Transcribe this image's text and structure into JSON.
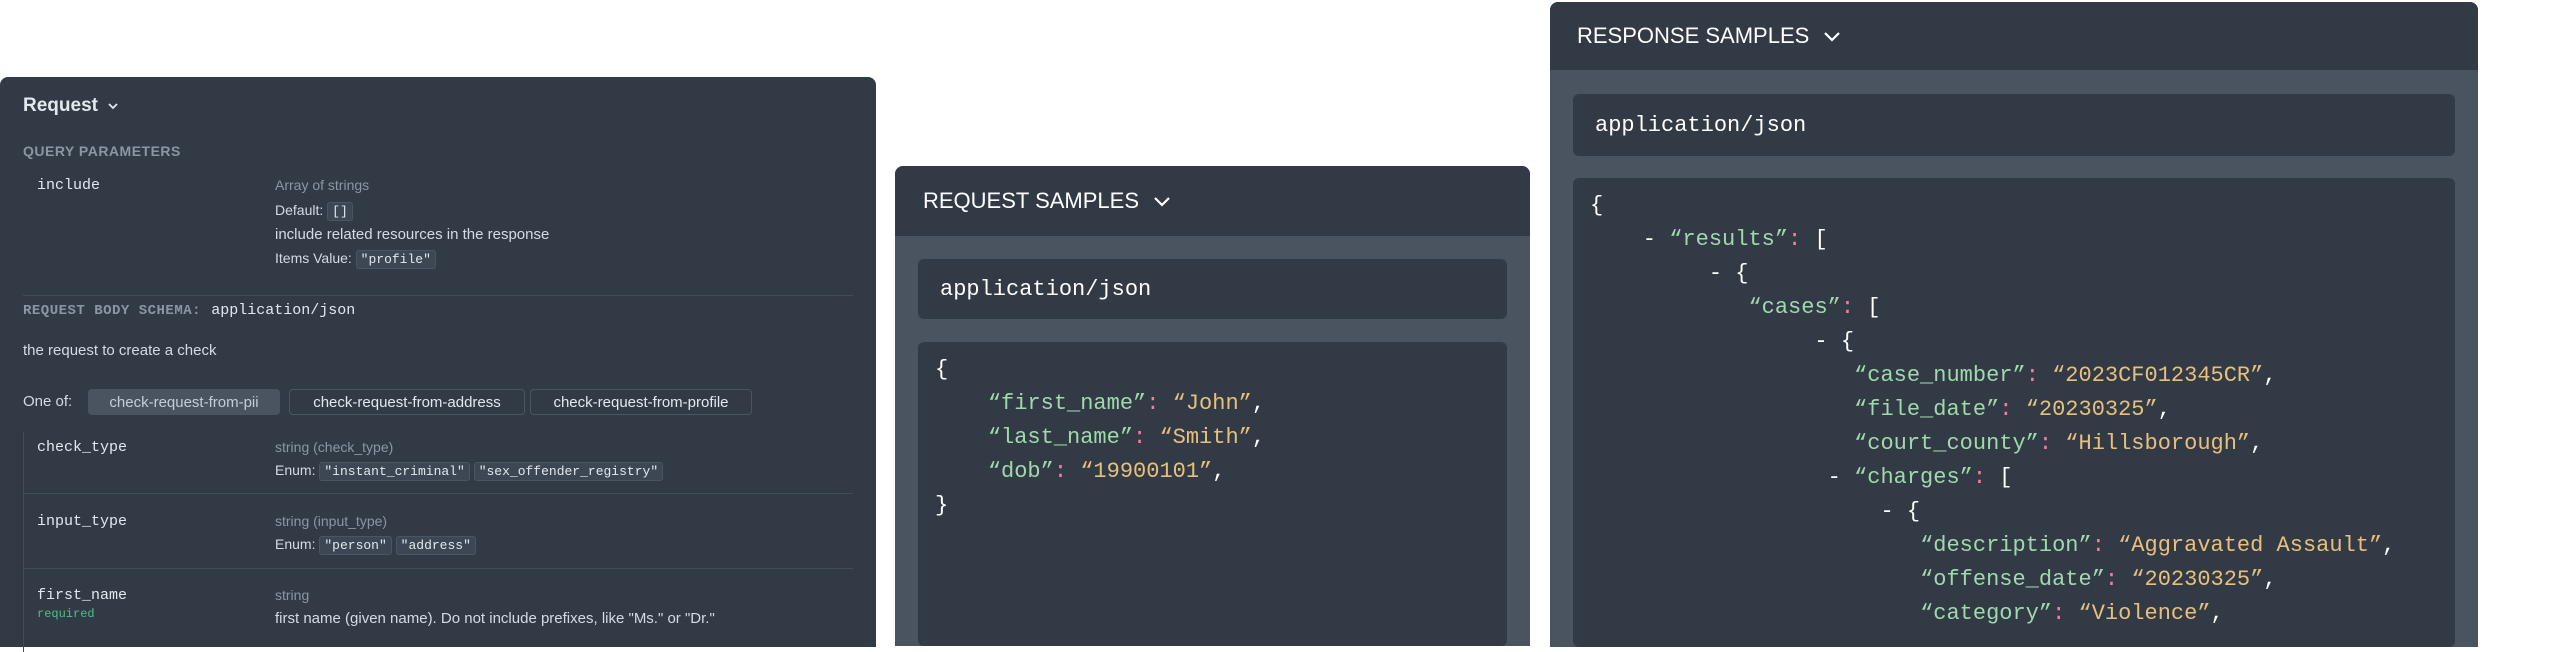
{
  "request": {
    "title": "Request",
    "query_params_heading": "QUERY PARAMETERS",
    "include": {
      "name": "include",
      "type": "Array of strings",
      "default_label": "Default:",
      "default_value": "[]",
      "description": "include related resources in the response",
      "items_label": "Items Value:",
      "items_value": "\"profile\""
    },
    "body_schema_label": "REQUEST BODY SCHEMA:",
    "body_schema_value": "application/json",
    "body_description": "the request to create a check",
    "one_of_label": "One of:",
    "one_of_tabs": [
      "check-request-from-pii",
      "check-request-from-address",
      "check-request-from-profile"
    ],
    "fields": [
      {
        "name": "check_type",
        "type": "string (check_type)",
        "enum_label": "Enum:",
        "enums": [
          "\"instant_criminal\"",
          "\"sex_offender_registry\""
        ]
      },
      {
        "name": "input_type",
        "type": "string (input_type)",
        "enum_label": "Enum:",
        "enums": [
          "\"person\"",
          "\"address\""
        ]
      },
      {
        "name": "first_name",
        "required": "required",
        "type": "string",
        "description": "first name (given name). Do not include prefixes, like \"Ms.\" or \"Dr.\""
      }
    ]
  },
  "request_samples": {
    "header": "REQUEST SAMPLES",
    "mime": "application/json",
    "lines": [
      [
        {
          "t": "p",
          "v": "{"
        }
      ],
      [
        {
          "t": "p",
          "v": "    "
        },
        {
          "t": "k",
          "v": "“first_name”"
        },
        {
          "t": "pu",
          "v": ": "
        },
        {
          "t": "s",
          "v": "“John”"
        },
        {
          "t": "p",
          "v": ","
        }
      ],
      [
        {
          "t": "p",
          "v": "    "
        },
        {
          "t": "k",
          "v": "“last_name”"
        },
        {
          "t": "pu",
          "v": ": "
        },
        {
          "t": "s",
          "v": "“Smith”"
        },
        {
          "t": "p",
          "v": ","
        }
      ],
      [
        {
          "t": "p",
          "v": "    "
        },
        {
          "t": "k",
          "v": "“dob”"
        },
        {
          "t": "pu",
          "v": ": "
        },
        {
          "t": "s",
          "v": "“19900101”"
        },
        {
          "t": "p",
          "v": ","
        }
      ],
      [
        {
          "t": "p",
          "v": "}"
        }
      ]
    ]
  },
  "response_samples": {
    "header": "RESPONSE SAMPLES",
    "mime": "application/json",
    "lines": [
      [
        {
          "t": "p",
          "v": "{"
        }
      ],
      [
        {
          "t": "p",
          "v": "    - "
        },
        {
          "t": "k",
          "v": "“results”"
        },
        {
          "t": "pu",
          "v": ": "
        },
        {
          "t": "p",
          "v": "["
        }
      ],
      [
        {
          "t": "p",
          "v": "         - {"
        }
      ],
      [
        {
          "t": "p",
          "v": "            "
        },
        {
          "t": "k",
          "v": "“cases”"
        },
        {
          "t": "pu",
          "v": ": "
        },
        {
          "t": "p",
          "v": "["
        }
      ],
      [
        {
          "t": "p",
          "v": "                 - {"
        }
      ],
      [
        {
          "t": "p",
          "v": "                    "
        },
        {
          "t": "k",
          "v": "“case_number”"
        },
        {
          "t": "pu",
          "v": ": "
        },
        {
          "t": "s",
          "v": "“2023CF012345CR”"
        },
        {
          "t": "p",
          "v": ","
        }
      ],
      [
        {
          "t": "p",
          "v": "                    "
        },
        {
          "t": "k",
          "v": "“file_date”"
        },
        {
          "t": "pu",
          "v": ": "
        },
        {
          "t": "s",
          "v": "“20230325”"
        },
        {
          "t": "p",
          "v": ","
        }
      ],
      [
        {
          "t": "p",
          "v": "                    "
        },
        {
          "t": "k",
          "v": "“court_county”"
        },
        {
          "t": "pu",
          "v": ": "
        },
        {
          "t": "s",
          "v": "“Hillsborough”"
        },
        {
          "t": "p",
          "v": ","
        }
      ],
      [
        {
          "t": "p",
          "v": "                  - "
        },
        {
          "t": "k",
          "v": "“charges”"
        },
        {
          "t": "pu",
          "v": ": "
        },
        {
          "t": "p",
          "v": "["
        }
      ],
      [
        {
          "t": "p",
          "v": "                      - {"
        }
      ],
      [
        {
          "t": "p",
          "v": "                         "
        },
        {
          "t": "k",
          "v": "“description”"
        },
        {
          "t": "pu",
          "v": ": "
        },
        {
          "t": "s",
          "v": "“Aggravated Assault”"
        },
        {
          "t": "p",
          "v": ","
        }
      ],
      [
        {
          "t": "p",
          "v": "                         "
        },
        {
          "t": "k",
          "v": "“offense_date”"
        },
        {
          "t": "pu",
          "v": ": "
        },
        {
          "t": "s",
          "v": "“20230325”"
        },
        {
          "t": "p",
          "v": ","
        }
      ],
      [
        {
          "t": "p",
          "v": "                         "
        },
        {
          "t": "k",
          "v": "“category”"
        },
        {
          "t": "pu",
          "v": ": "
        },
        {
          "t": "s",
          "v": "“Violence”"
        },
        {
          "t": "p",
          "v": ","
        }
      ]
    ]
  }
}
